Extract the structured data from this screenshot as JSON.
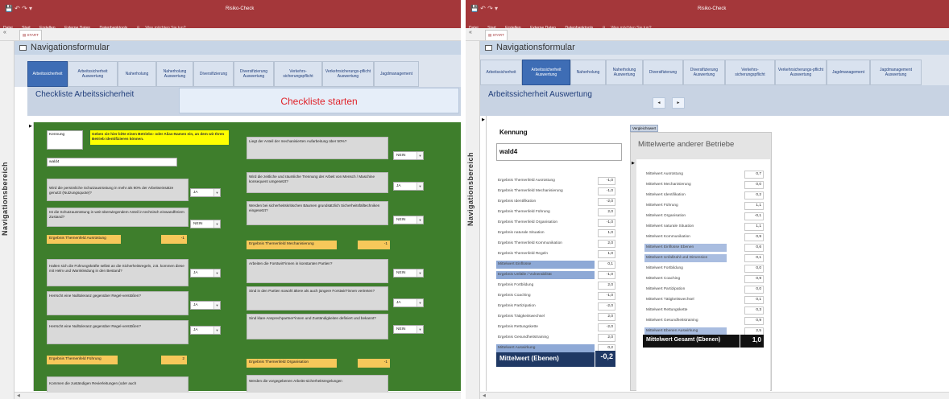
{
  "app": {
    "title": "Risiko-Check",
    "ribbon_tabs": [
      "Datei",
      "Start",
      "Erstellen",
      "Externe Daten",
      "Datenbanktools"
    ],
    "tell_me": "Was möchten Sie tun?",
    "document_tab": "START",
    "nav_pane_label": "Navigationsbereich",
    "form_title": "Navigationsformular"
  },
  "nav_buttons": [
    "Arbeitssicherheit",
    "Arbeitssicherheit Auswertung",
    "Naherholung",
    "Naherholung Auswertung",
    "Diversifizierung",
    "Diversifizierung Auswertung",
    "Verkehrs-sicherungspflicht",
    "Verkehrsicherungs-pflicht Auswertung",
    "Jagdmanagement",
    "Jagdmanagement Auswertung"
  ],
  "left_window": {
    "heading": "Checkliste Arbeitssicherheit",
    "start_button": "Checkliste starten",
    "kennung_label": "Kennung",
    "kennung_hint": "Geben sie hier bitte einen Betriebs- oder Alias-Namen ein, an dem wir Ihren Betrieb identifizieren können.",
    "kennung_value": "wald4",
    "left_questions": [
      {
        "text": "Wird die persönliche Schutzausrüstung in mehr als 90% der Arbeitseinsätze genutzt (Nutzungsquote)?",
        "answer": "JA"
      },
      {
        "text": "Ist die Schutzausrüstung in weit überwiegendem Anteil in technisch einwandfreiem Zustand?",
        "answer": "NEIN"
      }
    ],
    "result_left_1": {
      "label": "Ergebnis Themenfeld Ausrüstung",
      "value": "-1"
    },
    "left_questions_2": [
      {
        "text": "Halten sich die Führungskräfte selbst an die Sicherheitsregeln, z.B. kommen diese mit Helm und Warnkleidung in den Bestand?",
        "answer": "JA"
      },
      {
        "text": "Herrscht eine Nulltoleranz gegenüber Regel-verstößen?",
        "answer": "JA"
      },
      {
        "text": "Herrscht eine Nulltoleranz gegenüber Regel-verstößen?",
        "answer": "JA"
      }
    ],
    "result_left_2": {
      "label": "Ergebnis Themenfeld Führung",
      "value": "2"
    },
    "left_cut_question": "Kommen die zuständigen Revierleitungen (oder auch",
    "right_questions": [
      {
        "text": "Liegt der Anteil der mechanisierten Aufarbeitung über 50%?",
        "answer": "NEIN"
      },
      {
        "text": "Wird die zeitliche und räumliche Trennung der Arbeit von Mensch / Maschine konsequent umgesetzt?",
        "answer": "JA"
      },
      {
        "text": "Werden bei sicherheitskritischen Bäumen grundsätzlich Sicherheitsfälltechniken eingesetzt?",
        "answer": "NEIN"
      }
    ],
    "result_right_1": {
      "label": "Ergebnis Themenfeld Mechanisierung",
      "value": "-1"
    },
    "right_questions_2": [
      {
        "text": "Arbeiten die Forstwirt*innen in konstanten Partien?",
        "answer": "NEIN"
      },
      {
        "text": "Sind in den Partien sowohl ältere als auch jüngere Forstwirt*innen vertreten?",
        "answer": "JA"
      },
      {
        "text": "Sind klare Ansprechpartner*innen und Zuständigkeiten definiert und bekannt?",
        "answer": "NEIN"
      }
    ],
    "result_right_2": {
      "label": "Ergebnis Themenfeld Organisation",
      "value": "-1"
    },
    "right_cut_question": "Werden die vorgegebenen Arbeits-sicherheitsregelungen"
  },
  "right_window": {
    "heading": "Arbeitssicherheit Auswertung",
    "prev_label": "◄",
    "next_label": "►",
    "kennung_label": "Kennung",
    "kennung_value": "wald4",
    "results": [
      {
        "label": "Ergebnis Themenfeld Ausrüstung",
        "value": "-1,0"
      },
      {
        "label": "Ergebnis Themenfeld Mechanisierung",
        "value": "-1,0"
      },
      {
        "label": "Ergebnis Identifikation",
        "value": "-2,0"
      },
      {
        "label": "Ergebnis Themenfeld Führung",
        "value": "2,0"
      },
      {
        "label": "Ergebnis Themenfeld Organisation",
        "value": "-1,0"
      },
      {
        "label": "Ergebnis naturale Situation",
        "value": "1,0"
      },
      {
        "label": "Ergebnis Themenfeld Kommunikation",
        "value": "2,0"
      },
      {
        "label": "Ergebnis Themenfeld Regeln",
        "value": "1,0"
      },
      {
        "label": "Mittelwert Einflüsse",
        "value": "0,1"
      },
      {
        "label": "Ergebnis Unfälle / Vulnerabilität",
        "value": "-1,0"
      },
      {
        "label": "Ergebnis Fortbildung",
        "value": "2,0"
      },
      {
        "label": "Ergebnis Coaching",
        "value": "-1,0"
      },
      {
        "label": "Ergebnis Partizipation",
        "value": "-2,0"
      },
      {
        "label": "Ergebnis Tätigkeitswechsel",
        "value": "2,0"
      },
      {
        "label": "Ergebnis Rettungskette",
        "value": "-2,0"
      },
      {
        "label": "Ergebnis Gesundheitstraining",
        "value": "2,0"
      },
      {
        "label": "Mittelwert Auswirkung",
        "value": "0,2"
      }
    ],
    "total_label": "Mittelwert (Ebenen)",
    "total_value": "-0,2",
    "compare_button": "Vergleichswert",
    "compare_heading": "Mittelwerte anderer Betriebe",
    "compare": [
      {
        "label": "Mittelwert Ausrüstung",
        "value": "0,7"
      },
      {
        "label": "Mittelwert Mechanisierung",
        "value": "0,0"
      },
      {
        "label": "Mittelwert Identifikation",
        "value": "0,2"
      },
      {
        "label": "Mittelwert Führung",
        "value": "1,1"
      },
      {
        "label": "Mittelwert Organisation",
        "value": "-0,1"
      },
      {
        "label": "Mittelwert naturale Situation",
        "value": "1,1"
      },
      {
        "label": "Mittelwert Kommunikation",
        "value": "0,9"
      },
      {
        "label": "Mittelwert Einflüsse Ebenen",
        "value": "0,6"
      },
      {
        "label": "Mittelwert Unfallzahl und Dimension",
        "value": "0,1"
      },
      {
        "label": "Mittelwert Fortbildung",
        "value": "0,0"
      },
      {
        "label": "Mittelwert Coaching",
        "value": "0,9"
      },
      {
        "label": "Mittelwert Partizipation",
        "value": "0,0"
      },
      {
        "label": "Mittelwert Tätigkeitswechsel",
        "value": "0,1"
      },
      {
        "label": "Mittelwert Rettungskette",
        "value": "0,3"
      },
      {
        "label": "Mittelwert Gesundheitstraining",
        "value": "0,9"
      },
      {
        "label": "Mittelwert Ebenen Auswirkung",
        "value": "2,5"
      }
    ],
    "compare_total_label": "Mittelwert Gesamt (Ebenen)",
    "compare_total_value": "1,0"
  }
}
